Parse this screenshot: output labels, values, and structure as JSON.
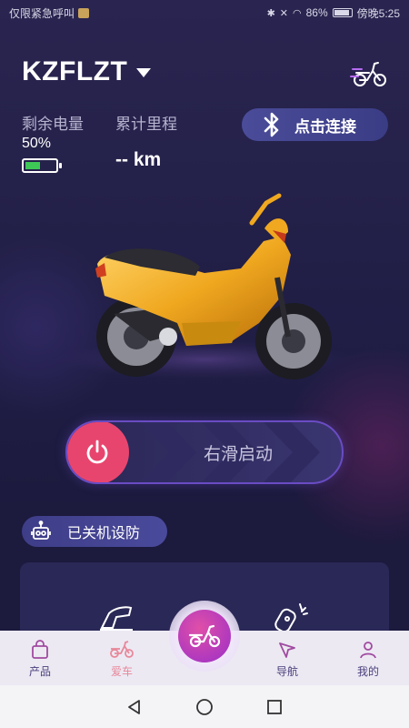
{
  "status_bar": {
    "carrier": "仅限紧急呼叫",
    "battery": "86%",
    "time": "傍晚5:25"
  },
  "header": {
    "device_name": "KZFLZT"
  },
  "stats": {
    "battery_label": "剩余电量",
    "battery_value": "50%",
    "battery_level": 0.5,
    "mileage_label": "累计里程",
    "mileage_value": "-- km"
  },
  "connect_button": {
    "label": "点击连接"
  },
  "swipe": {
    "label": "右滑启动"
  },
  "state_pill": {
    "label": "已关机设防"
  },
  "bottom_nav": {
    "items": [
      {
        "label": "产品",
        "icon": "bag-icon"
      },
      {
        "label": "爱车",
        "icon": "scooter-icon"
      },
      {
        "label": "导航",
        "icon": "navigation-icon"
      },
      {
        "label": "我的",
        "icon": "person-icon"
      }
    ]
  },
  "colors": {
    "accent": "#e8456e",
    "battery_green": "#3ec856",
    "nav_active": "#e8889a",
    "nav_inactive": "#4b3f7a"
  }
}
